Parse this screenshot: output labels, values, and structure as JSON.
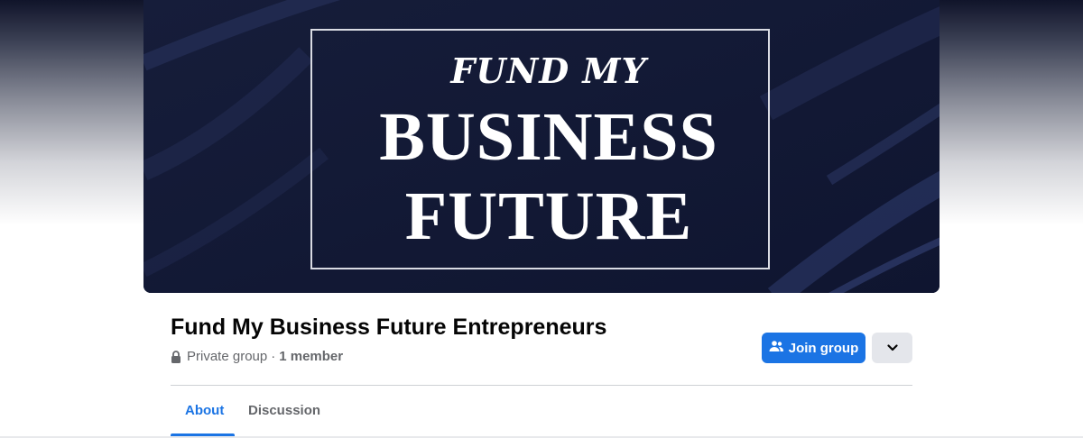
{
  "cover": {
    "line1": "FUND MY",
    "line2": "BUSINESS",
    "line3": "FUTURE"
  },
  "group": {
    "title": "Fund My Business Future Entrepreneurs",
    "privacy": "Private group",
    "separator": "·",
    "members": "1 member"
  },
  "actions": {
    "join_label": "Join group"
  },
  "tabs": [
    {
      "label": "About",
      "active": true
    },
    {
      "label": "Discussion",
      "active": false
    }
  ],
  "colors": {
    "accent": "#1b74e4",
    "cover_bg": "#131a33",
    "secondary_text": "#65676b"
  },
  "icons": {
    "lock": "lock-icon",
    "join": "people-icon",
    "more": "chevron-down-icon"
  }
}
